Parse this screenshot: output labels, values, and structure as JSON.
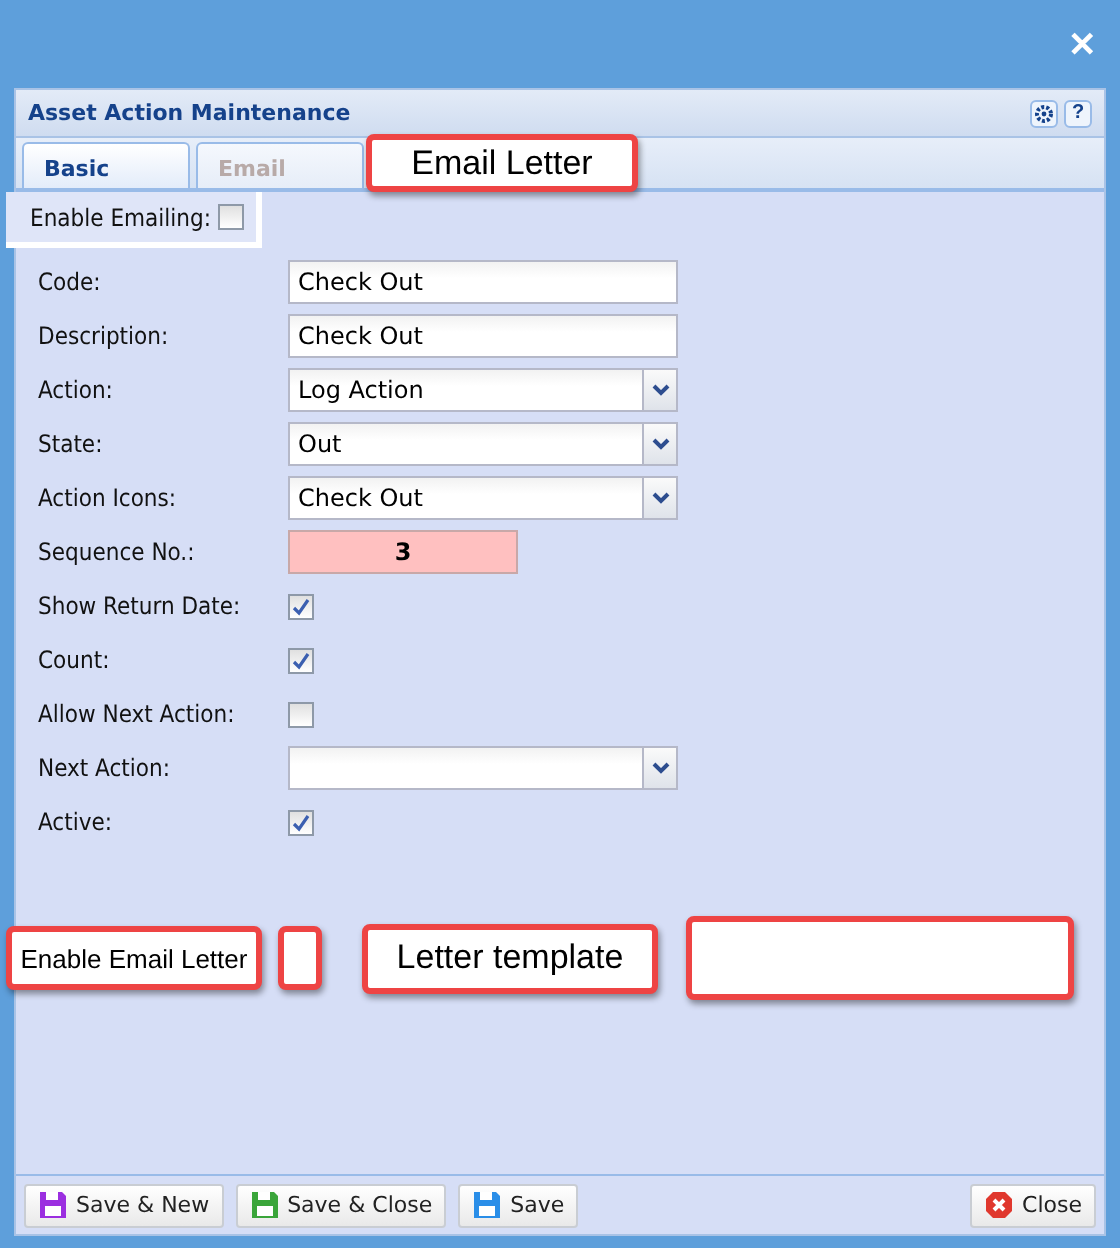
{
  "window": {
    "close": "✕"
  },
  "panel": {
    "title": "Asset Action Maintenance",
    "tools": [
      {
        "kind": "settings"
      },
      {
        "kind": "help",
        "label": "?"
      }
    ]
  },
  "tabs": [
    {
      "label": "Basic",
      "selected": true
    },
    {
      "label": "Email",
      "selected": false
    }
  ],
  "enable_emailing": {
    "label": "Enable Emailing:",
    "checked": false
  },
  "fields": [
    {
      "kind": "text",
      "label": "Code:",
      "value": "Check Out"
    },
    {
      "kind": "text",
      "label": "Description:",
      "value": "Check Out"
    },
    {
      "kind": "select",
      "label": "Action:",
      "value": "Log Action"
    },
    {
      "kind": "select",
      "label": "State:",
      "value": "Out"
    },
    {
      "kind": "select",
      "label": "Action Icons:",
      "value": "Check Out"
    },
    {
      "kind": "number",
      "label": "Sequence No.:",
      "value": "3"
    },
    {
      "kind": "checkbox",
      "label": "Show Return Date:",
      "checked": true
    },
    {
      "kind": "checkbox",
      "label": "Count:",
      "checked": true
    },
    {
      "kind": "checkbox",
      "label": "Allow Next Action:",
      "checked": false
    },
    {
      "kind": "select",
      "label": "Next Action:"
    },
    {
      "kind": "checkbox",
      "label": "Active:",
      "checked": true
    }
  ],
  "callouts": {
    "top": "Email Letter",
    "bottom": [
      {
        "kind": "label",
        "text": "Enable Email Letter"
      },
      {
        "kind": "checkbox"
      },
      {
        "kind": "heading",
        "text": "Letter template"
      },
      {
        "kind": "field"
      }
    ]
  },
  "footer": {
    "buttons": [
      {
        "label": "Save & New",
        "color": "#9b2fe0"
      },
      {
        "label": "Save & Close",
        "color": "#3aa53a"
      },
      {
        "label": "Save",
        "color": "#2a8ee8"
      }
    ],
    "close": "Close"
  }
}
